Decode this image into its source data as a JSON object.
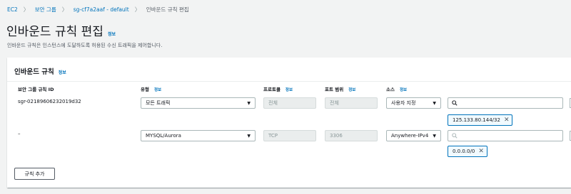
{
  "breadcrumb": {
    "items": [
      {
        "label": "EC2",
        "link": true
      },
      {
        "label": "보안 그룹",
        "link": true
      },
      {
        "label": "sg-cf7a2aaf - default",
        "link": true
      },
      {
        "label": "인바운드 규칙 편집",
        "link": false
      }
    ]
  },
  "page": {
    "title": "인바운드 규칙 편집",
    "info": "정보",
    "description": "인바운드 규칙은 인스턴스에 도달하도록 허용된 수신 트래픽을 제어합니다."
  },
  "panel": {
    "title": "인바운드 규칙",
    "info": "정보",
    "columns": {
      "rule_id": "보안 그룹 규칙 ID",
      "type": "유형",
      "protocol": "프로토콜",
      "port_range": "포트 범위",
      "source": "소스"
    },
    "column_info": "정보",
    "rows": [
      {
        "rule_id": "sgr-02189606232019d32",
        "type": "모든 트래픽",
        "protocol": "전체",
        "port_range": "전체",
        "source_type": "사용자 지정",
        "source_token": "125.133.80.144/32"
      },
      {
        "rule_id": "–",
        "type": "MYSQL/Aurora",
        "protocol": "TCP",
        "port_range": "3306",
        "source_type": "Anywhere-IPv4",
        "source_token": "0.0.0.0/0"
      }
    ],
    "add_rule_label": "규칙 추가"
  },
  "icons": {
    "search": "search-icon",
    "caret": "caret-down-icon",
    "remove": "close-icon",
    "breadcrumb_sep": "chevron-right-icon"
  },
  "colors": {
    "link": "#0073bb",
    "background": "#f2f3f3",
    "token_border": "#0073bb"
  }
}
